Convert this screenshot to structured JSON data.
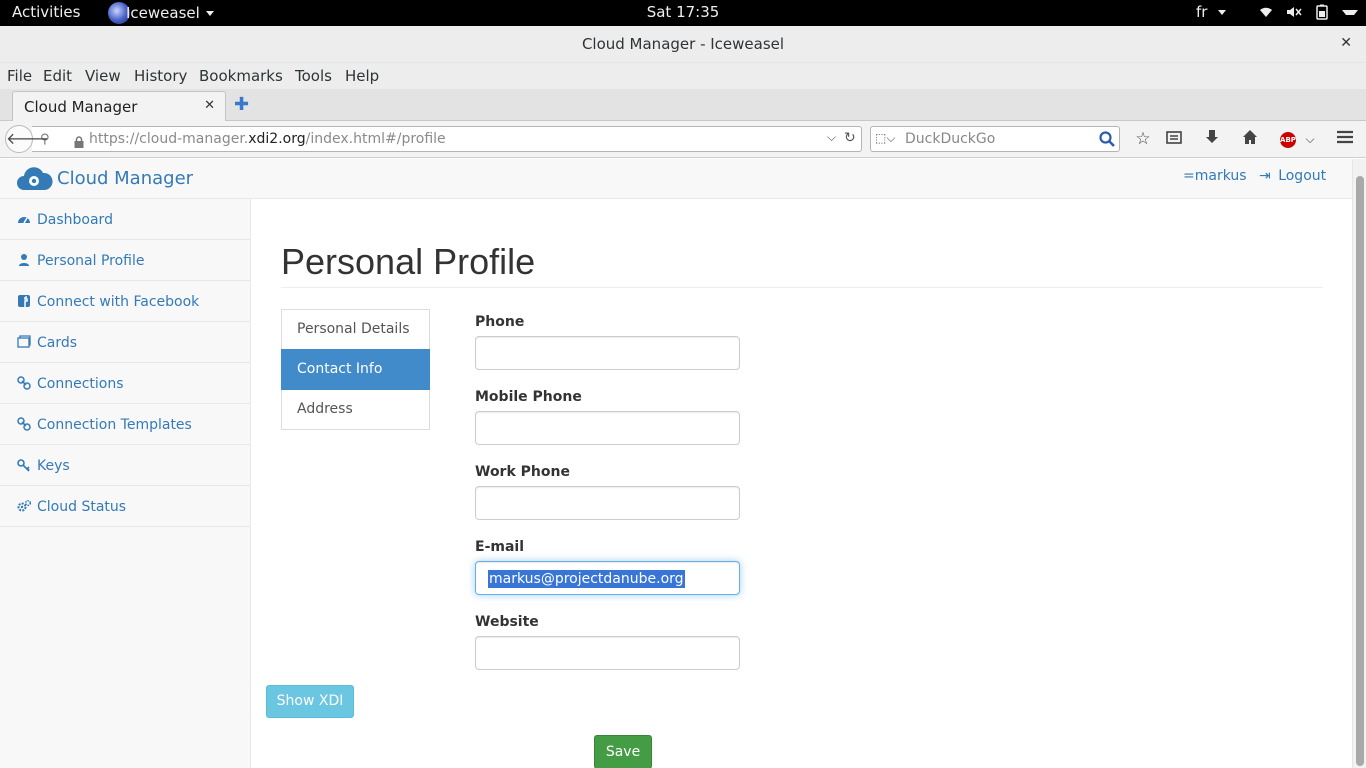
{
  "system": {
    "activities": "Activities",
    "app_name": "Iceweasel",
    "clock": "Sat 17:35",
    "keyboard": "fr"
  },
  "window": {
    "title": "Cloud Manager - Iceweasel"
  },
  "menubar": [
    "File",
    "Edit",
    "View",
    "History",
    "Bookmarks",
    "Tools",
    "Help"
  ],
  "tab": {
    "label": "Cloud Manager"
  },
  "urlbar": {
    "prefix": "https://cloud-manager.",
    "domain": "xdi2.org",
    "path": "/index.html#/profile"
  },
  "search": {
    "placeholder": "DuckDuckGo"
  },
  "app": {
    "brand": "Cloud Manager",
    "user": "=markus",
    "logout": "Logout"
  },
  "sidebar": {
    "items": [
      {
        "label": "Dashboard",
        "icon": "dashboard-icon"
      },
      {
        "label": "Personal Profile",
        "icon": "user-icon"
      },
      {
        "label": "Connect with Facebook",
        "icon": "facebook-icon"
      },
      {
        "label": "Cards",
        "icon": "card-icon"
      },
      {
        "label": "Connections",
        "icon": "link-icon"
      },
      {
        "label": "Connection Templates",
        "icon": "link-icon"
      },
      {
        "label": "Keys",
        "icon": "key-icon"
      },
      {
        "label": "Cloud Status",
        "icon": "cogs-icon"
      }
    ]
  },
  "page": {
    "title": "Personal Profile",
    "subnav": [
      "Personal Details",
      "Contact Info",
      "Address"
    ],
    "active_subnav": "Contact Info",
    "fields": {
      "phone": {
        "label": "Phone",
        "value": ""
      },
      "mobile": {
        "label": "Mobile Phone",
        "value": ""
      },
      "work": {
        "label": "Work Phone",
        "value": ""
      },
      "email": {
        "label": "E-mail",
        "value": "markus@projectdanube.org"
      },
      "website": {
        "label": "Website",
        "value": ""
      }
    },
    "show_xdi": "Show XDI",
    "save": "Save"
  },
  "colors": {
    "link": "#337ab7",
    "active_tab": "#428bca",
    "info_button": "#5bc0de",
    "success_button": "#449d44"
  }
}
